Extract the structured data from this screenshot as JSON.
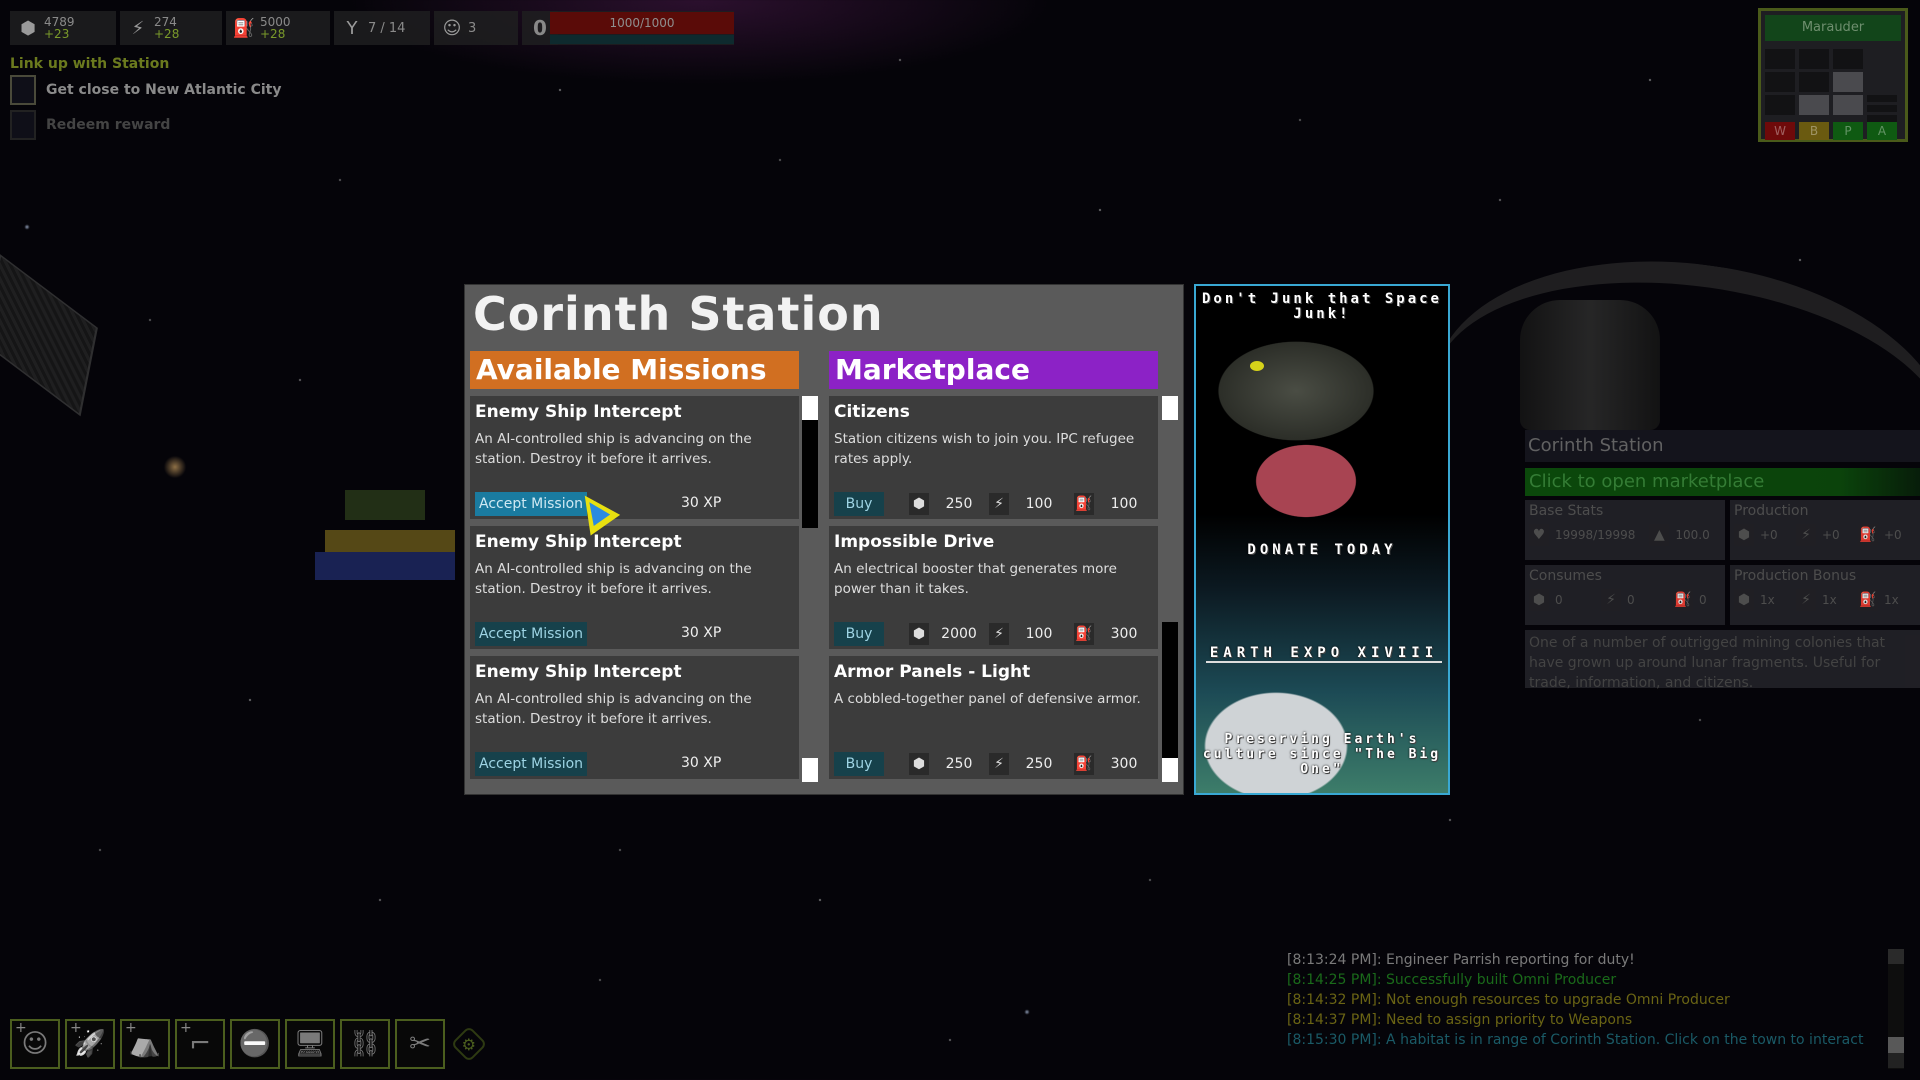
{
  "resources": {
    "crystal": {
      "icon": "crystal-icon",
      "value": "4789",
      "delta": "+23"
    },
    "power": {
      "icon": "lightning-icon",
      "value": "274",
      "delta": "+28"
    },
    "fuel": {
      "icon": "fuel-can-icon",
      "value": "5000",
      "delta": "+28"
    },
    "population": {
      "icon": "person-icon",
      "value": "7 / 14"
    },
    "crew": {
      "icon": "astronaut-icon",
      "value": "3"
    },
    "counter": "0",
    "hull": {
      "label": "1000/1000",
      "fraction": 1.0
    }
  },
  "objectives": {
    "title": "Link up with Station",
    "items": [
      {
        "label": "Get close to New Atlantic City",
        "checked": false
      },
      {
        "label": "Redeem reward",
        "checked": false
      }
    ]
  },
  "ship": {
    "name": "Marauder",
    "priority_keys": [
      {
        "label": "W",
        "color": "#6e0a0a"
      },
      {
        "label": "B",
        "color": "#6a5a10"
      },
      {
        "label": "P",
        "color": "#0f5a12"
      },
      {
        "label": "A",
        "color": "#0f5a12"
      }
    ],
    "levels": {
      "W": 0,
      "B": 1,
      "P": 2,
      "A": 3
    }
  },
  "station_dialog": {
    "title": "Corinth Station",
    "missions": {
      "header": "Available Missions",
      "header_color": "#d16f21",
      "items": [
        {
          "title": "Enemy Ship Intercept",
          "description": "An AI-controlled ship is advancing on the station. Destroy it before it arrives.",
          "button": "Accept Mission",
          "reward": "30 XP"
        },
        {
          "title": "Enemy Ship Intercept",
          "description": "An AI-controlled ship is advancing on the station. Destroy it before it arrives.",
          "button": "Accept Mission",
          "reward": "30 XP"
        },
        {
          "title": "Enemy Ship Intercept",
          "description": "An AI-controlled ship is advancing on the station. Destroy it before it arrives.",
          "button": "Accept Mission",
          "reward": "30 XP"
        }
      ]
    },
    "marketplace": {
      "header": "Marketplace",
      "header_color": "#8c22c6",
      "items": [
        {
          "title": "Citizens",
          "description": "Station citizens wish to join you. IPC refugee rates apply.",
          "button": "Buy",
          "cost": {
            "crystal": "250",
            "power": "100",
            "fuel": "100"
          }
        },
        {
          "title": "Impossible Drive",
          "description": "An electrical booster that generates more power than it takes.",
          "button": "Buy",
          "cost": {
            "crystal": "2000",
            "power": "100",
            "fuel": "300"
          }
        },
        {
          "title": "Armor Panels - Light",
          "description": "A cobbled-together panel of defensive armor.",
          "button": "Buy",
          "cost": {
            "crystal": "250",
            "power": "250",
            "fuel": "300"
          }
        }
      ]
    }
  },
  "advertisement": {
    "headline": "Don't Junk that Space Junk!",
    "donate": "DONATE TODAY",
    "event": "EARTH EXPO XIVIII",
    "tagline": "Preserving Earth's culture since \"The Big One\""
  },
  "station_info": {
    "name": "Corinth Station",
    "action": "Click to open marketplace",
    "base_stats": {
      "label": "Base Stats",
      "health": "19998/19998",
      "weight": "100.0"
    },
    "production": {
      "label": "Production",
      "crystal": "+0",
      "power": "+0",
      "fuel": "+0"
    },
    "consumes": {
      "label": "Consumes",
      "crystal": "0",
      "power": "0",
      "fuel": "0"
    },
    "production_bonus": {
      "label": "Production Bonus",
      "crystal": "1x",
      "power": "1x",
      "fuel": "1x"
    },
    "description": "One of a number of outrigged mining colonies that have grown up around lunar fragments. Useful for trade, information, and citizens."
  },
  "log": [
    {
      "time": "[8:13:24 PM]",
      "message": "Engineer Parrish reporting for duty!",
      "color": "white"
    },
    {
      "time": "[8:14:25 PM]",
      "message": "Successfully built Omni Producer",
      "color": "green"
    },
    {
      "time": "[8:14:32 PM]",
      "message": "Not enough resources to upgrade Omni Producer",
      "color": "olive"
    },
    {
      "time": "[8:14:37 PM]",
      "message": "Need to assign priority to Weapons",
      "color": "olive"
    },
    {
      "time": "[8:15:30 PM]",
      "message": "A habitat is in range of Corinth Station. Click on the town to interact",
      "color": "cyan"
    }
  ],
  "toolbar": [
    {
      "name": "hire-crew",
      "icon": "astronaut-plus-icon",
      "glyph": "☺",
      "plus": "+"
    },
    {
      "name": "build-rocket",
      "icon": "rocket-plus-icon",
      "glyph": "🚀",
      "plus": "+"
    },
    {
      "name": "build-habitat",
      "icon": "tent-plus-icon",
      "glyph": "⛺",
      "plus": "+"
    },
    {
      "name": "build-weapon",
      "icon": "gun-plus-icon",
      "glyph": "⌐",
      "plus": "+"
    },
    {
      "name": "stop",
      "icon": "stop-sign-icon",
      "glyph": "⛔",
      "plus": ""
    },
    {
      "name": "computer",
      "icon": "computer-icon",
      "glyph": "🖥",
      "plus": ""
    },
    {
      "name": "link",
      "icon": "chain-link-icon",
      "glyph": "⛓",
      "plus": ""
    },
    {
      "name": "unlink",
      "icon": "broken-chain-icon",
      "glyph": "✂",
      "plus": ""
    }
  ],
  "settings_glyph": "⚙"
}
